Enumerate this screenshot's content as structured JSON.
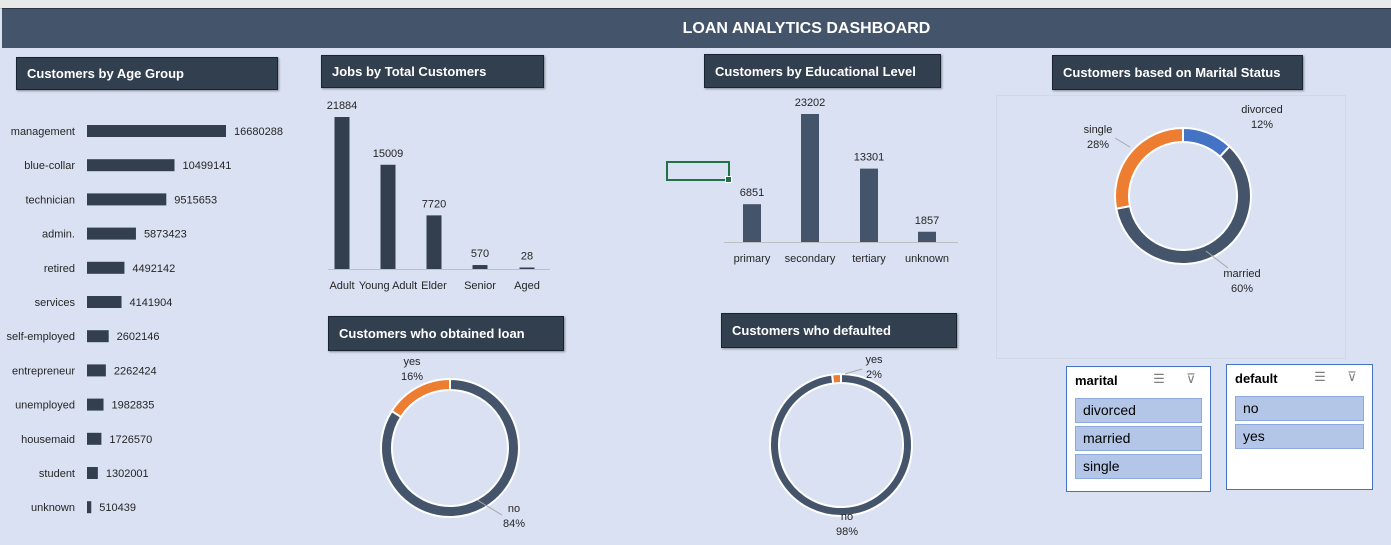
{
  "dashboard": {
    "title": "LOAN ANALYTICS DASHBOARD"
  },
  "charts": {
    "age": {
      "title": "Customers by Age Group"
    },
    "jobs": {
      "title": "Jobs by Total Customers"
    },
    "edu": {
      "title": "Customers by Educational Level"
    },
    "marital": {
      "title": "Customers based on Marital Status"
    },
    "loan": {
      "title": "Customers who obtained loan"
    },
    "default": {
      "title": "Customers who defaulted"
    }
  },
  "colors": {
    "series_dark": "#333f4f",
    "series_mid": "#44546a",
    "orange": "#ed7d31",
    "blue": "#4472c4"
  },
  "chart_data": [
    {
      "id": "age",
      "type": "bar",
      "orientation": "horizontal",
      "title": "Customers by Age Group",
      "categories": [
        "management",
        "blue-collar",
        "technician",
        "admin.",
        "retired",
        "services",
        "self-employed",
        "entrepreneur",
        "unemployed",
        "housemaid",
        "student",
        "unknown"
      ],
      "values": [
        16680288,
        10499141,
        9515653,
        5873423,
        4492142,
        4141904,
        2602146,
        2262424,
        1982835,
        1726570,
        1302001,
        510439
      ],
      "data_labels": [
        "16680288",
        "10499141",
        "9515653",
        "5873423",
        "4492142",
        "4141904",
        "2602146",
        "2262424",
        "1982835",
        "1726570",
        "1302001",
        "510439"
      ]
    },
    {
      "id": "jobs",
      "type": "bar",
      "title": "Jobs by Total Customers",
      "categories": [
        "Adult",
        "Young Adult",
        "Elder",
        "Senior",
        "Aged"
      ],
      "values": [
        21884,
        15009,
        7720,
        570,
        28
      ],
      "data_labels": [
        "21884",
        "15009",
        "7720",
        "570",
        "28"
      ]
    },
    {
      "id": "edu",
      "type": "bar",
      "title": "Customers by Educational Level",
      "categories": [
        "primary",
        "secondary",
        "tertiary",
        "unknown"
      ],
      "values": [
        6851,
        23202,
        13301,
        1857
      ],
      "data_labels": [
        "6851",
        "23202",
        "13301",
        "1857"
      ]
    },
    {
      "id": "marital",
      "type": "pie",
      "variant": "donut",
      "title": "Customers based on Marital Status",
      "categories": [
        "divorced",
        "married",
        "single"
      ],
      "values": [
        12,
        60,
        28
      ],
      "percent_labels": [
        "12%",
        "60%",
        "28%"
      ],
      "colors": [
        "#4472c4",
        "#44546a",
        "#ed7d31"
      ]
    },
    {
      "id": "loan",
      "type": "pie",
      "variant": "donut",
      "title": "Customers who obtained loan",
      "categories": [
        "no",
        "yes"
      ],
      "values": [
        84,
        16
      ],
      "percent_labels": [
        "84%",
        "16%"
      ],
      "colors": [
        "#44546a",
        "#ed7d31"
      ]
    },
    {
      "id": "default",
      "type": "pie",
      "variant": "donut",
      "title": "Customers who defaulted",
      "categories": [
        "no",
        "yes"
      ],
      "values": [
        98,
        2
      ],
      "percent_labels": [
        "98%",
        "2%"
      ],
      "colors": [
        "#44546a",
        "#ed7d31"
      ]
    }
  ],
  "slicers": {
    "marital": {
      "header": "marital",
      "items": [
        "divorced",
        "married",
        "single"
      ]
    },
    "default": {
      "header": "default",
      "items": [
        "no",
        "yes"
      ]
    }
  }
}
